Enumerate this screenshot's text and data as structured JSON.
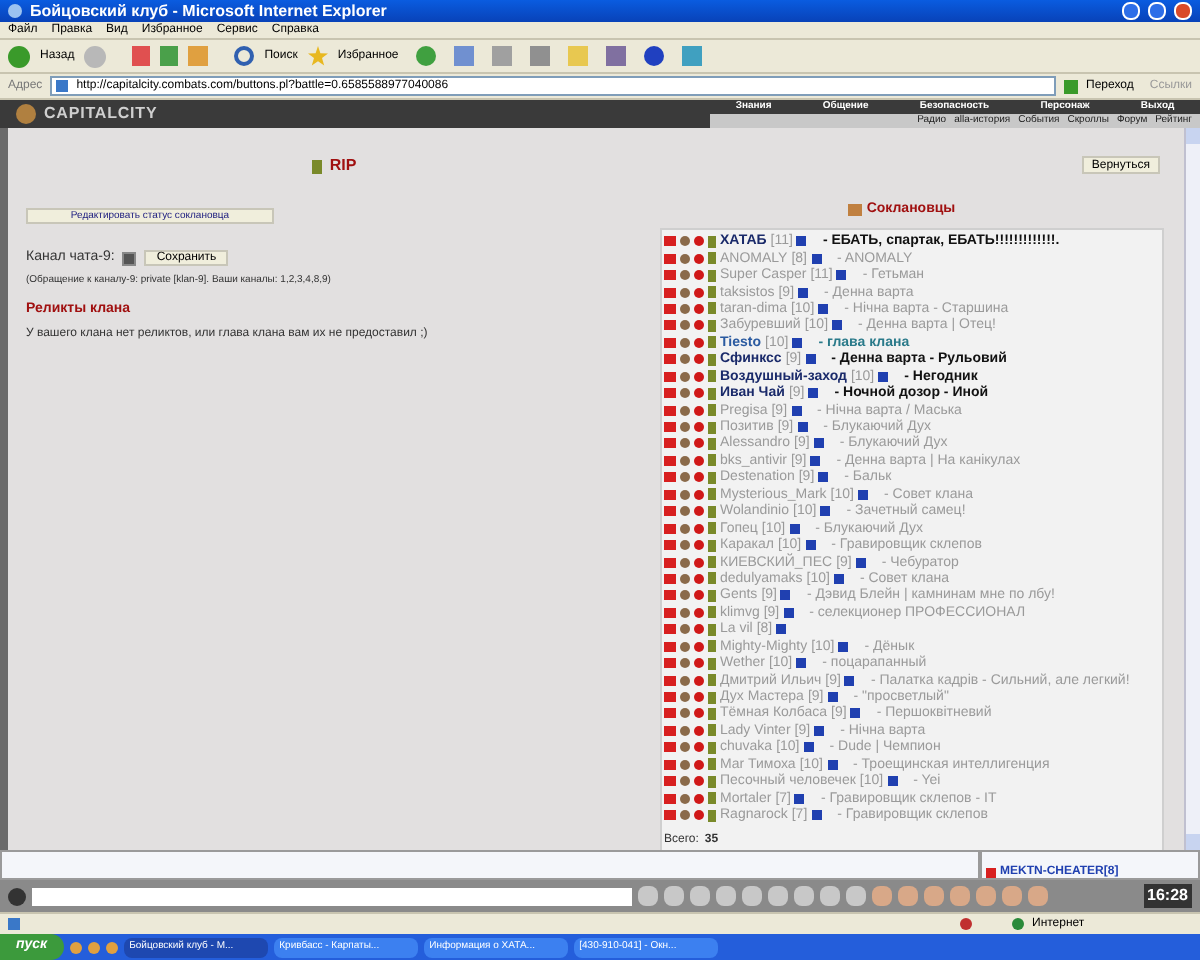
{
  "window": {
    "title": "Бойцовский клуб - Microsoft Internet Explorer"
  },
  "menu": [
    "Файл",
    "Правка",
    "Вид",
    "Избранное",
    "Сервис",
    "Справка"
  ],
  "toolbar": {
    "back": "Назад",
    "search": "Поиск",
    "favorites": "Избранное"
  },
  "address": {
    "label": "Адрес",
    "url": "http://capitalcity.combats.com/buttons.pl?battle=0.6585588977040086",
    "go": "Переход",
    "links": "Ссылки"
  },
  "game_header": {
    "logo": "CAPITALCITY",
    "nav": [
      "Знания",
      "Общение",
      "Безопасность",
      "Персонаж",
      "Выход"
    ],
    "subnav": [
      "Радио",
      "alla-история",
      "События",
      "Скроллы",
      "Форум",
      "Рейтинг"
    ]
  },
  "left": {
    "rank": "RIP",
    "edit_button": "Редактировать статус соклановца",
    "channel_label": "Канал чата-9:",
    "channel_checked": true,
    "save_button": "Сохранить",
    "channel_note": "(Обращение к каналу-9: private [klan-9]. Ваши каналы: 1,2,3,4,8,9)",
    "relics_title": "Реликты клана",
    "relics_text": "У вашего клана нет реликтов, или глава клана вам их не предоставил ;)"
  },
  "right": {
    "back_button": "Вернуться",
    "title": "Соклановцы",
    "total_label": "Всего:",
    "total": "35",
    "members": [
      {
        "name": "ХАТАБ",
        "level": "[11]",
        "status": "- ЕБАТЬ, спартак, ЕБАТЬ!!!!!!!!!!!!!.",
        "online": true,
        "leader": false
      },
      {
        "name": "ANOMALY",
        "level": "[8]",
        "status": "- ANOMALY",
        "online": false,
        "leader": false
      },
      {
        "name": "Super Casper",
        "level": "[11]",
        "status": "- Гетьман",
        "online": false,
        "leader": false
      },
      {
        "name": "taksistos",
        "level": "[9]",
        "status": "- Денна варта",
        "online": false,
        "leader": false
      },
      {
        "name": "taran-dima",
        "level": "[10]",
        "status": "- Нічна варта - Старшина",
        "online": false,
        "leader": false
      },
      {
        "name": "Забуревший",
        "level": "[10]",
        "status": "- Денна варта | Отец!",
        "online": false,
        "leader": false
      },
      {
        "name": "Tiesto",
        "level": "[10]",
        "status": "- глава клана",
        "online": true,
        "leader": true
      },
      {
        "name": "Сфинксс",
        "level": "[9]",
        "status": "- Денна варта - Рульовий",
        "online": true,
        "leader": false
      },
      {
        "name": "Воздушный-заход",
        "level": "[10]",
        "status": "- Негодник",
        "online": true,
        "leader": false
      },
      {
        "name": "Иван Чай",
        "level": "[9]",
        "status": "- Ночной дозор - Иной",
        "online": true,
        "leader": false
      },
      {
        "name": "Pregisa",
        "level": "[9]",
        "status": "- Нічна варта / Маська",
        "online": false,
        "leader": false
      },
      {
        "name": "Позитив",
        "level": "[9]",
        "status": "- Блукаючий Дух",
        "online": false,
        "leader": false
      },
      {
        "name": "Alessandro",
        "level": "[9]",
        "status": "- Блукаючий Дух",
        "online": false,
        "leader": false
      },
      {
        "name": "bks_antivir",
        "level": "[9]",
        "status": "- Денна варта | На канікулах",
        "online": false,
        "leader": false
      },
      {
        "name": "Destenation",
        "level": "[9]",
        "status": "- Бальк",
        "online": false,
        "leader": false
      },
      {
        "name": "Mysterious_Mark",
        "level": "[10]",
        "status": "- Совет клана",
        "online": false,
        "leader": false
      },
      {
        "name": "Wolandinio",
        "level": "[10]",
        "status": "- Зачетный самец!",
        "online": false,
        "leader": false
      },
      {
        "name": "Гопец",
        "level": "[10]",
        "status": "- Блукаючий Дух",
        "online": false,
        "leader": false
      },
      {
        "name": "Каракал",
        "level": "[10]",
        "status": "- Гравировщик склепов",
        "online": false,
        "leader": false
      },
      {
        "name": "КИЕВСКИЙ_ПЕС",
        "level": "[9]",
        "status": "- Чебуратор",
        "online": false,
        "leader": false
      },
      {
        "name": "dedulyamaks",
        "level": "[10]",
        "status": "- Совет клана",
        "online": false,
        "leader": false
      },
      {
        "name": "Gents",
        "level": "[9]",
        "status": "- Дэвид Блейн | камнинам мне по лбу!",
        "online": false,
        "leader": false
      },
      {
        "name": "klimvg",
        "level": "[9]",
        "status": "- селекционер ПРОФЕССИОНАЛ",
        "online": false,
        "leader": false
      },
      {
        "name": "La vil",
        "level": "[8]",
        "online": false,
        "leader": false
      },
      {
        "name": "Mighty-Mighty",
        "level": "[10]",
        "status": "- Дёнык",
        "online": false,
        "leader": false
      },
      {
        "name": "Wether",
        "level": "[10]",
        "status": "- поцарапанный",
        "online": false,
        "leader": false
      },
      {
        "name": "Дмитрий Ильич",
        "level": "[9]",
        "status": "- Палатка кадрів - Сильний, але легкий!",
        "online": false,
        "leader": false
      },
      {
        "name": "Дух Мастера",
        "level": "[9]",
        "status": "- \"просветлый\"",
        "online": false,
        "leader": false
      },
      {
        "name": "Тёмная Колбаса",
        "level": "[9]",
        "status": "- Першоквітневий",
        "online": false,
        "leader": false
      },
      {
        "name": "Lady Vinter",
        "level": "[9]",
        "status": "- Нічна варта",
        "online": false,
        "leader": false
      },
      {
        "name": "chuvaka",
        "level": "[10]",
        "status": "- Dude | Чемпион",
        "online": false,
        "leader": false
      },
      {
        "name": "Mar Тимоха",
        "level": "[10]",
        "status": "- Троещинская интеллигенция",
        "online": false,
        "leader": false
      },
      {
        "name": "Песочный человечек",
        "level": "[10]",
        "status": "- Yei",
        "online": false,
        "leader": false
      },
      {
        "name": "Mortaler",
        "level": "[7]",
        "status": "- Гравировщик склепов - IT",
        "online": false,
        "leader": false
      },
      {
        "name": "Ragnarock",
        "level": "[7]",
        "status": "- Гравировщик склепов",
        "online": false,
        "leader": false
      }
    ]
  },
  "chat_users": [
    "MEKTN-CHEATER[8]"
  ],
  "clock": "16:28",
  "status_bar": {
    "zone": "Интернет"
  },
  "taskbar": {
    "start": "пуск",
    "tasks": [
      {
        "label": "Бойцовский клуб - M...",
        "selected": true
      },
      {
        "label": "Кривбасс - Карпаты...",
        "selected": false
      },
      {
        "label": "Информация о ХАТА...",
        "selected": false
      },
      {
        "label": "[430-910-041] - Окн...",
        "selected": false
      }
    ]
  }
}
